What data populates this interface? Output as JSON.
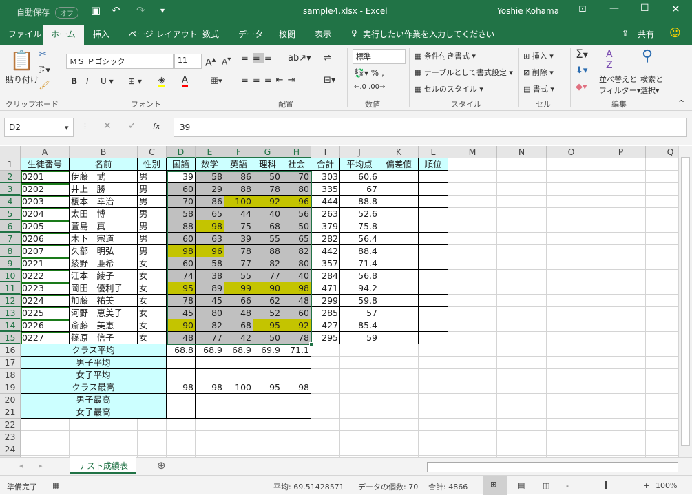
{
  "titlebar": {
    "autosave": "自動保存",
    "autosave_state": "オフ",
    "filename": "sample4.xlsx  -  Excel",
    "user": "Yoshie Kohama"
  },
  "tabs": [
    "ファイル",
    "ホーム",
    "挿入",
    "ページ レイアウト",
    "数式",
    "データ",
    "校閲",
    "表示"
  ],
  "tell_me": "実行したい作業を入力してください",
  "share": "共有",
  "ribbon": {
    "paste": "貼り付け",
    "clipboard": "クリップボード",
    "font_name": "ＭＳ Ｐゴシック",
    "font_size": "11",
    "font": "フォント",
    "alignment": "配置",
    "number_format": "標準",
    "number": "数値",
    "cond_format": "条件付き書式",
    "table_format": "テーブルとして書式設定",
    "cell_style": "セルのスタイル",
    "styles": "スタイル",
    "insert": "挿入",
    "delete": "削除",
    "format": "書式",
    "cells": "セル",
    "sort": "並べ替えと",
    "filter": "フィルター",
    "find": "検索と",
    "select": "選択",
    "editing": "編集",
    "colors": {
      "fill": "#ffff00",
      "font": "#ff0000"
    }
  },
  "formula": {
    "name_box": "D2",
    "fx": "fx",
    "value": "39"
  },
  "columns": [
    "A",
    "B",
    "C",
    "D",
    "E",
    "F",
    "G",
    "H",
    "I",
    "J",
    "K",
    "L",
    "M",
    "N",
    "O",
    "P",
    "Q"
  ],
  "headers": [
    "生徒番号",
    "名前",
    "性別",
    "国語",
    "数学",
    "英語",
    "理科",
    "社会",
    "合計",
    "平均点",
    "偏差値",
    "順位"
  ],
  "students": [
    [
      "0201",
      "伊藤　武",
      "男",
      "39",
      "58",
      "86",
      "50",
      "70",
      "303",
      "60.6"
    ],
    [
      "0202",
      "井上　勝",
      "男",
      "60",
      "29",
      "88",
      "78",
      "80",
      "335",
      "67"
    ],
    [
      "0203",
      "榎本　幸治",
      "男",
      "70",
      "86",
      "100",
      "92",
      "96",
      "444",
      "88.8"
    ],
    [
      "0204",
      "太田　博",
      "男",
      "58",
      "65",
      "44",
      "40",
      "56",
      "263",
      "52.6"
    ],
    [
      "0205",
      "萱島　真",
      "男",
      "88",
      "98",
      "75",
      "68",
      "50",
      "379",
      "75.8"
    ],
    [
      "0206",
      "木下　宗道",
      "男",
      "60",
      "63",
      "39",
      "55",
      "65",
      "282",
      "56.4"
    ],
    [
      "0207",
      "久部　明弘",
      "男",
      "98",
      "96",
      "78",
      "88",
      "82",
      "442",
      "88.4"
    ],
    [
      "0221",
      "綾野　亜希",
      "女",
      "60",
      "58",
      "77",
      "82",
      "80",
      "357",
      "71.4"
    ],
    [
      "0222",
      "江本　綾子",
      "女",
      "74",
      "38",
      "55",
      "77",
      "40",
      "284",
      "56.8"
    ],
    [
      "0223",
      "岡田　優利子",
      "女",
      "95",
      "89",
      "99",
      "90",
      "98",
      "471",
      "94.2"
    ],
    [
      "0224",
      "加藤　祐美",
      "女",
      "78",
      "45",
      "66",
      "62",
      "48",
      "299",
      "59.8"
    ],
    [
      "0225",
      "河野　恵美子",
      "女",
      "45",
      "80",
      "48",
      "52",
      "60",
      "285",
      "57"
    ],
    [
      "0226",
      "斎藤　美恵",
      "女",
      "90",
      "82",
      "68",
      "95",
      "92",
      "427",
      "85.4"
    ],
    [
      "0227",
      "篠原　信子",
      "女",
      "48",
      "77",
      "42",
      "50",
      "78",
      "295",
      "59"
    ]
  ],
  "highlighted_cells": [
    "F4",
    "G4",
    "H4",
    "E6",
    "D8",
    "E8",
    "D11",
    "F11",
    "G11",
    "H11",
    "D14",
    "G14",
    "H14"
  ],
  "highlight_color": "#c4c400",
  "range_fill_color": "#c0c0c0",
  "header_fill_color": "#ccffff",
  "summary": [
    {
      "label": "クラス平均",
      "values": [
        "68.8",
        "68.9",
        "68.9",
        "69.9",
        "71.1"
      ]
    },
    {
      "label": "男子平均",
      "values": [
        "",
        "",
        "",
        "",
        ""
      ]
    },
    {
      "label": "女子平均",
      "values": [
        "",
        "",
        "",
        "",
        ""
      ]
    },
    {
      "label": "クラス最高",
      "values": [
        "98",
        "98",
        "100",
        "95",
        "98"
      ]
    },
    {
      "label": "男子最高",
      "values": [
        "",
        "",
        "",
        "",
        ""
      ]
    },
    {
      "label": "女子最高",
      "values": [
        "",
        "",
        "",
        "",
        ""
      ]
    }
  ],
  "sheet_tab": "テスト成績表",
  "status": {
    "ready": "準備完了",
    "average": "平均: 69.51428571",
    "count": "データの個数: 70",
    "sum": "合計: 4866",
    "zoom": "100%",
    "zoom_level_percent": 100
  }
}
